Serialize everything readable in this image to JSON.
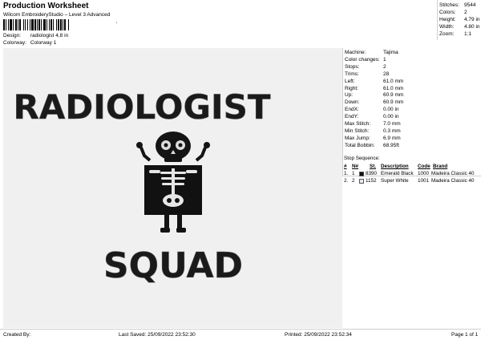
{
  "header": {
    "title": "Production Worksheet",
    "subtitle": "Wilcom EmbroideryStudio – Level 3 Advanced",
    "barcode_mark": "'",
    "design_label": "Design:",
    "design_value": "radiologist 4,8 in",
    "colorway_label": "Colorway:",
    "colorway_value": "Colorway 1"
  },
  "stats": [
    {
      "label": "Stitches:",
      "value": "9544"
    },
    {
      "label": "Colors:",
      "value": "2"
    },
    {
      "label": "Height:",
      "value": "4.79 in"
    },
    {
      "label": "Width:",
      "value": "4.80 in"
    },
    {
      "label": "Zoom:",
      "value": "1:1"
    }
  ],
  "design": {
    "line1": "RADIOLOGIST",
    "line2": "SQUAD"
  },
  "details": [
    {
      "label": "Machine:",
      "value": "Tajima"
    },
    {
      "label": "Color changes:",
      "value": "1"
    },
    {
      "label": "Stops:",
      "value": "2"
    },
    {
      "label": "Trims:",
      "value": "28"
    },
    {
      "label": "Left:",
      "value": "61.0 mm"
    },
    {
      "label": "Right:",
      "value": "61.0 mm"
    },
    {
      "label": "Up:",
      "value": "60.9 mm"
    },
    {
      "label": "Down:",
      "value": "60.9 mm"
    },
    {
      "label": "EndX:",
      "value": "0.00 in"
    },
    {
      "label": "EndY:",
      "value": "0.00 in"
    },
    {
      "label": "Max Stitch:",
      "value": "7.0 mm"
    },
    {
      "label": "Min Stitch:",
      "value": "0.3 mm"
    },
    {
      "label": "Max Jump:",
      "value": "6.9 mm"
    },
    {
      "label": "Total Bobbin:",
      "value": "68.95ft"
    }
  ],
  "stop_sequence": {
    "title": "Stop Sequence:",
    "headers": [
      "#",
      "N#",
      "St.",
      "Description",
      "Code",
      "Brand"
    ],
    "rows": [
      {
        "num": "1.",
        "n": "1",
        "color": "#111111",
        "st": "8390",
        "description": "Emerald Black",
        "code": "1000",
        "brand": "Madeira Classic 40"
      },
      {
        "num": "2.",
        "n": "2",
        "color": "#e8e8f4",
        "st": "1152",
        "description": "Super White",
        "code": "1001",
        "brand": "Madeira Classic 40"
      }
    ]
  },
  "footer": {
    "created_by": "Created By:",
    "last_saved": "Last Saved: 25/09/2022 23:52:30",
    "printed": "Printed: 25/09/2022 23:52:34",
    "page": "Page 1 of 1"
  }
}
